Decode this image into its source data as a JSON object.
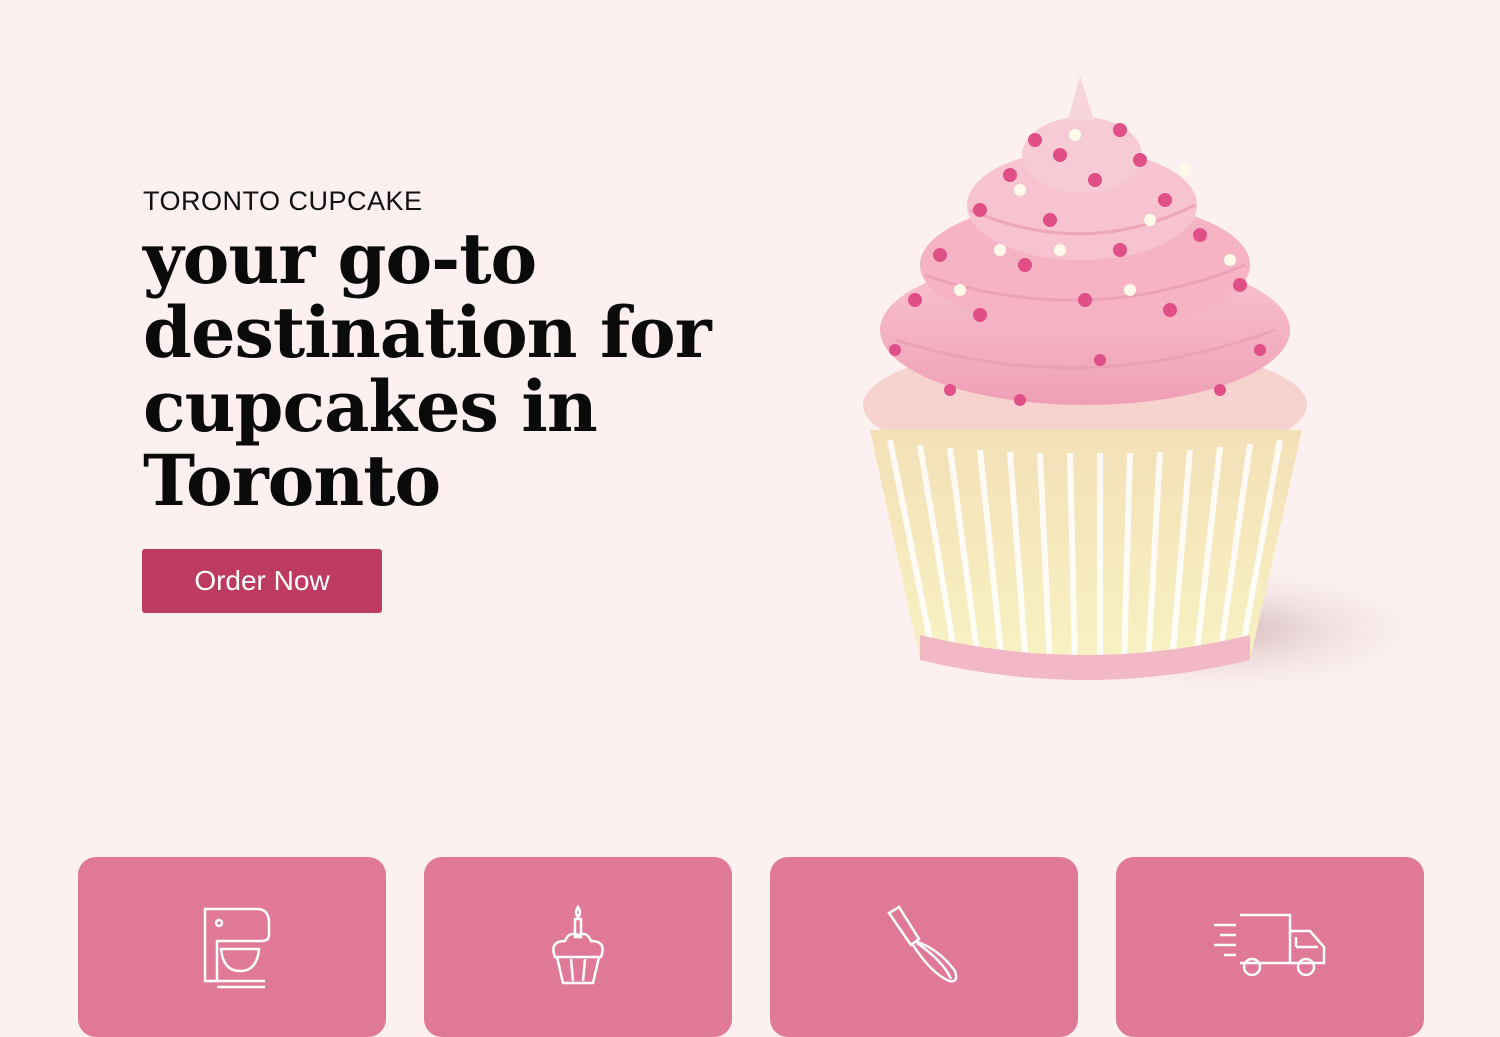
{
  "hero": {
    "eyebrow": "TORONTO CUPCAKE",
    "headline": "your go-to destination for cupcakes in Toronto",
    "cta_label": "Order Now",
    "image": "pink-frosted-cupcake-image"
  },
  "features": [
    {
      "icon": "stand-mixer-icon"
    },
    {
      "icon": "birthday-cupcake-icon"
    },
    {
      "icon": "whisk-icon"
    },
    {
      "icon": "delivery-truck-icon"
    }
  ],
  "colors": {
    "background": "#fcf0f0",
    "accent": "#bd3b61",
    "card": "#e07897",
    "frosting": "#f6bcc8",
    "sprinkle": "#e04f86"
  }
}
